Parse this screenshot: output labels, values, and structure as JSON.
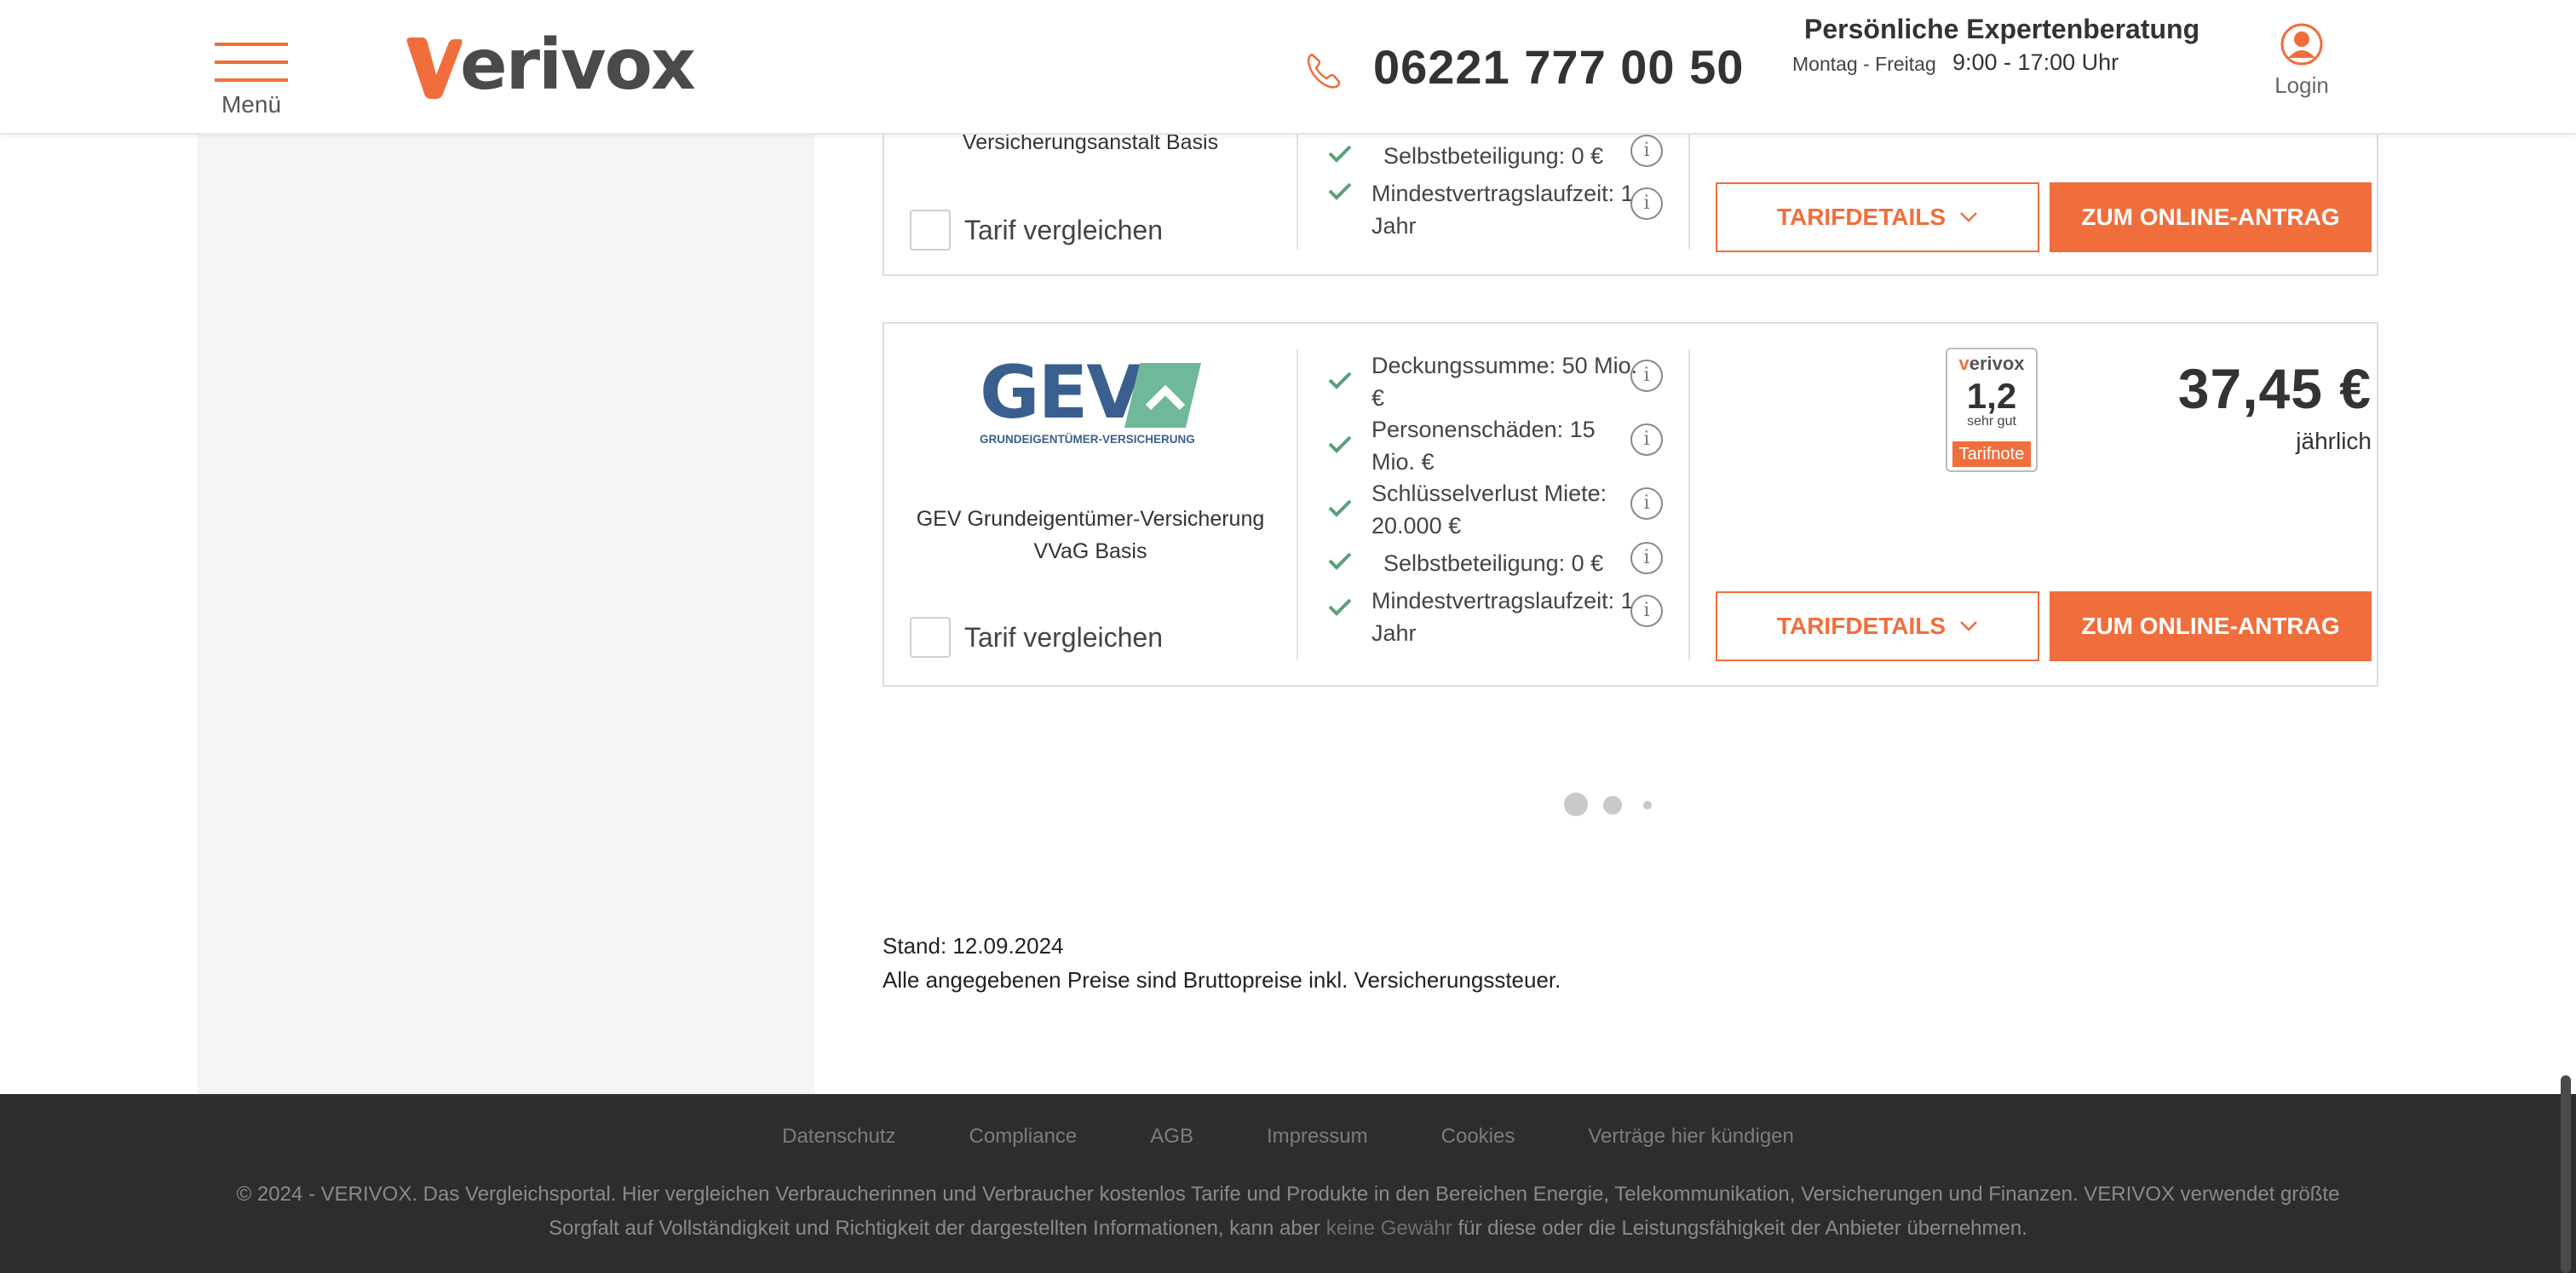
{
  "header": {
    "menu_label": "Menü",
    "logo_text": "erivox",
    "phone": "06221 777 00 50",
    "expert_title": "Persönliche Expertenberatung",
    "days": "Montag - Freitag",
    "hours": "9:00 - 17:00 Uhr",
    "login_label": "Login"
  },
  "colors": {
    "accent": "#f06e3c",
    "check": "#5aa07a",
    "footer_bg": "#2d2d2d"
  },
  "results": [
    {
      "provider": "Versicherungsanstalt Basis",
      "features": [
        {
          "text": "Selbstbeteiligung: 0 €"
        },
        {
          "text": "Mindestvertragslaufzeit: 1 Jahr"
        }
      ],
      "compare_label": "Tarif vergleichen",
      "details_label": "TARIFDETAILS",
      "apply_label": "ZUM ONLINE-ANTRAG"
    },
    {
      "logo_text": "GEV",
      "logo_subtext": "GRUNDEIGENTÜMER-VERSICHERUNG",
      "provider": "GEV Grundeigentümer-Versicherung VVaG Basis",
      "features": [
        {
          "text": "Deckungssumme: 50 Mio. €"
        },
        {
          "text": "Personenschäden: 15 Mio. €"
        },
        {
          "text": "Schlüsselverlust Miete: 20.000 €"
        },
        {
          "text": "Selbstbeteiligung: 0 €"
        },
        {
          "text": "Mindestvertragslaufzeit: 1 Jahr"
        }
      ],
      "badge": {
        "brand_v": "v",
        "brand": "erivox",
        "grade": "1,2",
        "grade_text": "sehr gut",
        "label": "Tarifnote"
      },
      "price": "37,45 €",
      "period": "jährlich",
      "compare_label": "Tarif vergleichen",
      "details_label": "TARIFDETAILS",
      "apply_label": "ZUM ONLINE-ANTRAG"
    }
  ],
  "info_glyph": "i",
  "stand": "Stand: 12.09.2024",
  "price_note": "Alle angegebenen Preise sind Bruttopreise inkl. Versicherungssteuer.",
  "footer": {
    "links": [
      "Datenschutz",
      "Compliance",
      "AGB",
      "Impressum",
      "Cookies",
      "Verträge hier kündigen"
    ],
    "copyright_1": "© 2024 - VERIVOX. Das Vergleichsportal. Hier vergleichen Verbraucherinnen und Verbraucher kostenlos Tarife und Produkte in den Bereichen Energie, Telekommunikation, Versicherungen und Finanzen. VERIVOX verwendet größte Sorgfalt auf Vollständigkeit und Richtigkeit der dargestellten Informationen, kann aber",
    "keine_gewaehr": "keine Gewähr",
    "copyright_2": "für diese oder die Leistungsfähigkeit der Anbieter übernehmen."
  }
}
